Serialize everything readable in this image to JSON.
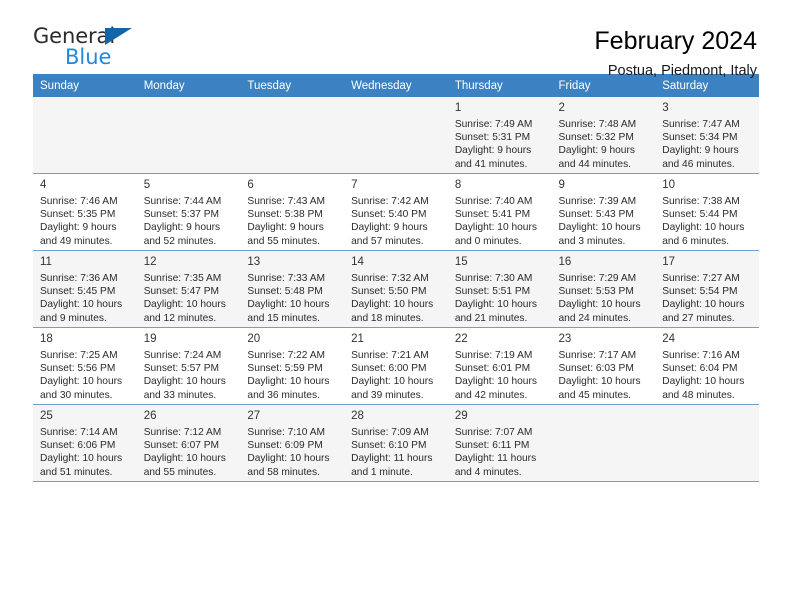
{
  "brand": {
    "name_top": "General",
    "name_bottom": "Blue",
    "accent_color": "#1464aa",
    "blue_color": "#2288dd"
  },
  "header": {
    "title": "February 2024",
    "subtitle": "Postua, Piedmont, Italy"
  },
  "theme": {
    "header_row_bg": "#3c81c1",
    "header_row_text": "#ffffff",
    "row_shaded_bg": "#f5f5f5",
    "cell_border": "#6f9fd0"
  },
  "weekdays": [
    "Sunday",
    "Monday",
    "Tuesday",
    "Wednesday",
    "Thursday",
    "Friday",
    "Saturday"
  ],
  "weeks": [
    [
      {
        "day": "",
        "detail": ""
      },
      {
        "day": "",
        "detail": ""
      },
      {
        "day": "",
        "detail": ""
      },
      {
        "day": "",
        "detail": ""
      },
      {
        "day": "1",
        "detail": "Sunrise: 7:49 AM\nSunset: 5:31 PM\nDaylight: 9 hours\nand 41 minutes."
      },
      {
        "day": "2",
        "detail": "Sunrise: 7:48 AM\nSunset: 5:32 PM\nDaylight: 9 hours\nand 44 minutes."
      },
      {
        "day": "3",
        "detail": "Sunrise: 7:47 AM\nSunset: 5:34 PM\nDaylight: 9 hours\nand 46 minutes."
      }
    ],
    [
      {
        "day": "4",
        "detail": "Sunrise: 7:46 AM\nSunset: 5:35 PM\nDaylight: 9 hours\nand 49 minutes."
      },
      {
        "day": "5",
        "detail": "Sunrise: 7:44 AM\nSunset: 5:37 PM\nDaylight: 9 hours\nand 52 minutes."
      },
      {
        "day": "6",
        "detail": "Sunrise: 7:43 AM\nSunset: 5:38 PM\nDaylight: 9 hours\nand 55 minutes."
      },
      {
        "day": "7",
        "detail": "Sunrise: 7:42 AM\nSunset: 5:40 PM\nDaylight: 9 hours\nand 57 minutes."
      },
      {
        "day": "8",
        "detail": "Sunrise: 7:40 AM\nSunset: 5:41 PM\nDaylight: 10 hours\nand 0 minutes."
      },
      {
        "day": "9",
        "detail": "Sunrise: 7:39 AM\nSunset: 5:43 PM\nDaylight: 10 hours\nand 3 minutes."
      },
      {
        "day": "10",
        "detail": "Sunrise: 7:38 AM\nSunset: 5:44 PM\nDaylight: 10 hours\nand 6 minutes."
      }
    ],
    [
      {
        "day": "11",
        "detail": "Sunrise: 7:36 AM\nSunset: 5:45 PM\nDaylight: 10 hours\nand 9 minutes."
      },
      {
        "day": "12",
        "detail": "Sunrise: 7:35 AM\nSunset: 5:47 PM\nDaylight: 10 hours\nand 12 minutes."
      },
      {
        "day": "13",
        "detail": "Sunrise: 7:33 AM\nSunset: 5:48 PM\nDaylight: 10 hours\nand 15 minutes."
      },
      {
        "day": "14",
        "detail": "Sunrise: 7:32 AM\nSunset: 5:50 PM\nDaylight: 10 hours\nand 18 minutes."
      },
      {
        "day": "15",
        "detail": "Sunrise: 7:30 AM\nSunset: 5:51 PM\nDaylight: 10 hours\nand 21 minutes."
      },
      {
        "day": "16",
        "detail": "Sunrise: 7:29 AM\nSunset: 5:53 PM\nDaylight: 10 hours\nand 24 minutes."
      },
      {
        "day": "17",
        "detail": "Sunrise: 7:27 AM\nSunset: 5:54 PM\nDaylight: 10 hours\nand 27 minutes."
      }
    ],
    [
      {
        "day": "18",
        "detail": "Sunrise: 7:25 AM\nSunset: 5:56 PM\nDaylight: 10 hours\nand 30 minutes."
      },
      {
        "day": "19",
        "detail": "Sunrise: 7:24 AM\nSunset: 5:57 PM\nDaylight: 10 hours\nand 33 minutes."
      },
      {
        "day": "20",
        "detail": "Sunrise: 7:22 AM\nSunset: 5:59 PM\nDaylight: 10 hours\nand 36 minutes."
      },
      {
        "day": "21",
        "detail": "Sunrise: 7:21 AM\nSunset: 6:00 PM\nDaylight: 10 hours\nand 39 minutes."
      },
      {
        "day": "22",
        "detail": "Sunrise: 7:19 AM\nSunset: 6:01 PM\nDaylight: 10 hours\nand 42 minutes."
      },
      {
        "day": "23",
        "detail": "Sunrise: 7:17 AM\nSunset: 6:03 PM\nDaylight: 10 hours\nand 45 minutes."
      },
      {
        "day": "24",
        "detail": "Sunrise: 7:16 AM\nSunset: 6:04 PM\nDaylight: 10 hours\nand 48 minutes."
      }
    ],
    [
      {
        "day": "25",
        "detail": "Sunrise: 7:14 AM\nSunset: 6:06 PM\nDaylight: 10 hours\nand 51 minutes."
      },
      {
        "day": "26",
        "detail": "Sunrise: 7:12 AM\nSunset: 6:07 PM\nDaylight: 10 hours\nand 55 minutes."
      },
      {
        "day": "27",
        "detail": "Sunrise: 7:10 AM\nSunset: 6:09 PM\nDaylight: 10 hours\nand 58 minutes."
      },
      {
        "day": "28",
        "detail": "Sunrise: 7:09 AM\nSunset: 6:10 PM\nDaylight: 11 hours\nand 1 minute."
      },
      {
        "day": "29",
        "detail": "Sunrise: 7:07 AM\nSunset: 6:11 PM\nDaylight: 11 hours\nand 4 minutes."
      },
      {
        "day": "",
        "detail": ""
      },
      {
        "day": "",
        "detail": ""
      }
    ]
  ]
}
